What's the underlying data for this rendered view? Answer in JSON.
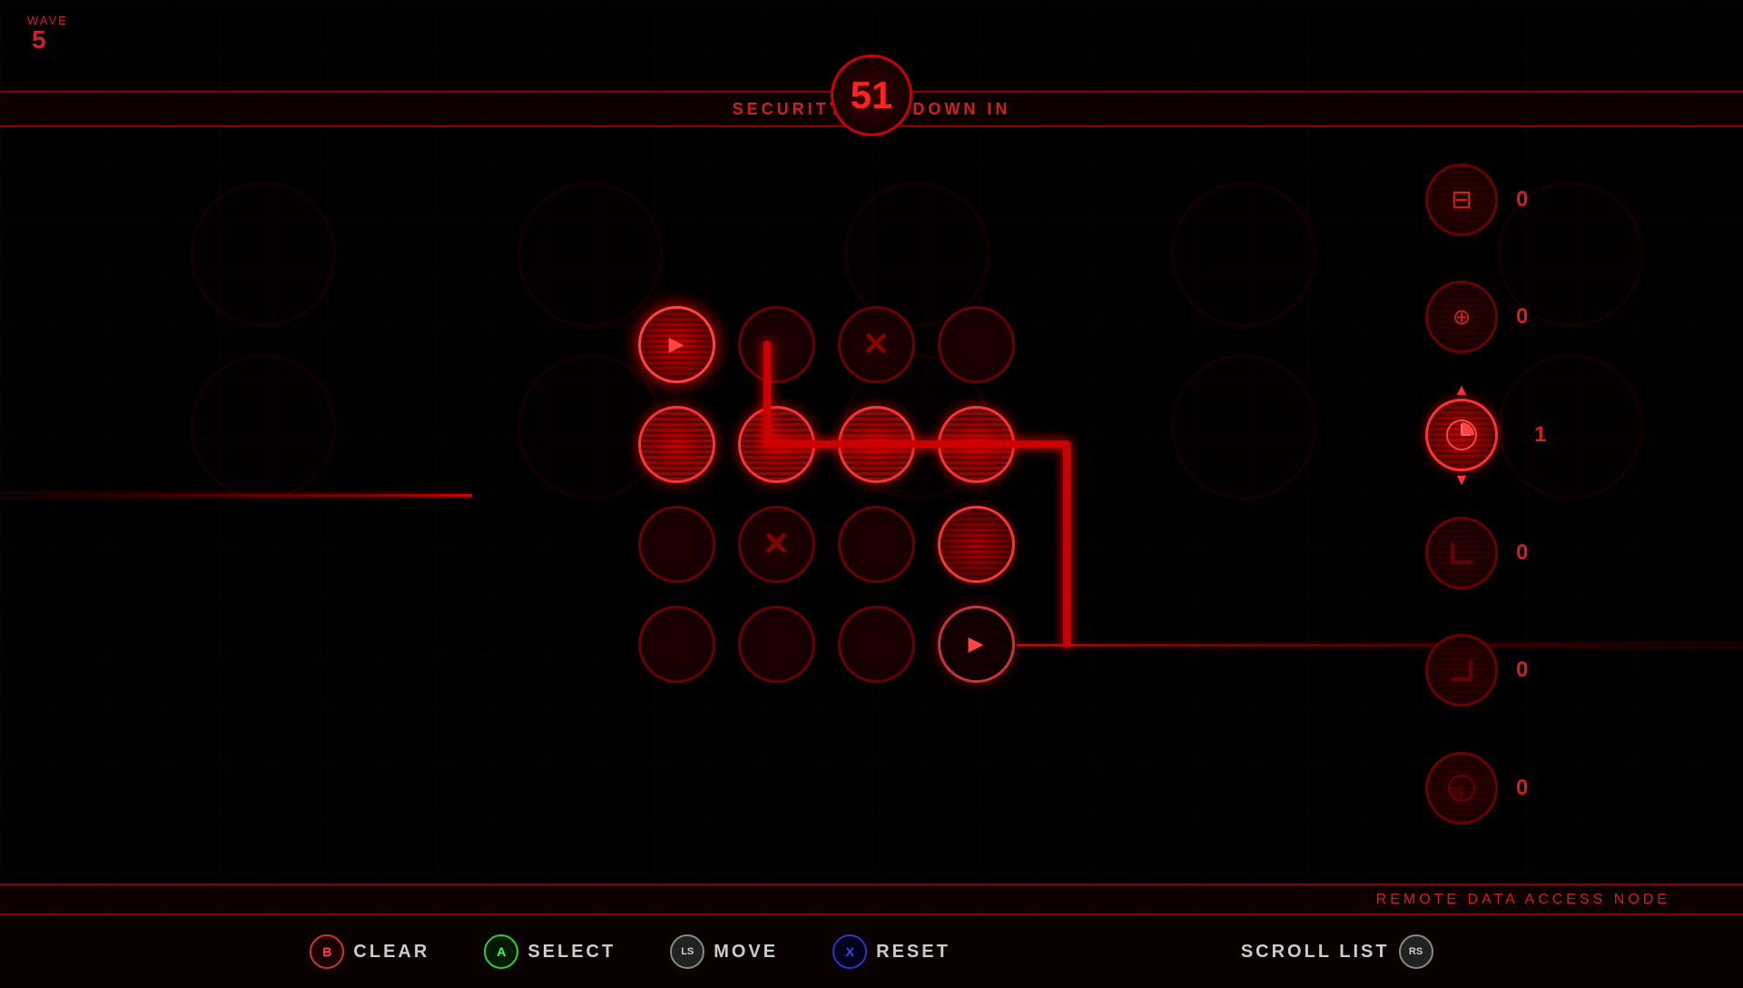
{
  "ui": {
    "wave_label": "WAVE",
    "wave_number": "5",
    "timer_value": "51",
    "header_text": "SECURITY LOCKDOWN IN",
    "footer_text": "REMOTE DATA ACCESS NODE",
    "buttons": [
      {
        "key": "B",
        "action": "CLEAR",
        "key_type": "btn-b"
      },
      {
        "key": "A",
        "action": "SELECT",
        "key_type": "btn-a"
      },
      {
        "key": "LS",
        "action": "MOVE",
        "key_type": "btn-ls"
      },
      {
        "key": "X",
        "action": "RESET",
        "key_type": "btn-x"
      }
    ],
    "scroll_label": "SCROLL LIST",
    "scroll_key": "RS"
  },
  "right_panel": [
    {
      "icon": "⊟",
      "count": "0",
      "active": false
    },
    {
      "icon": "⊕",
      "count": "0",
      "active": false
    },
    {
      "icon": "◔",
      "count": "1",
      "active": true
    },
    {
      "icon": "⌐",
      "count": "0",
      "active": false
    },
    {
      "icon": "⌐",
      "count": "0",
      "active": false
    },
    {
      "icon": "◔",
      "count": "0",
      "active": false
    }
  ],
  "grid": {
    "rows": 4,
    "cols": 4,
    "cells": [
      [
        {
          "state": "current",
          "arrow": "right"
        },
        {
          "state": "empty"
        },
        {
          "state": "marked-x"
        },
        {
          "state": "empty"
        }
      ],
      [
        {
          "state": "active"
        },
        {
          "state": "active"
        },
        {
          "state": "active"
        },
        {
          "state": "active"
        }
      ],
      [
        {
          "state": "empty"
        },
        {
          "state": "marked-x"
        },
        {
          "state": "empty"
        },
        {
          "state": "active-bottom"
        }
      ],
      [
        {
          "state": "empty"
        },
        {
          "state": "empty"
        },
        {
          "state": "empty"
        },
        {
          "state": "current-exit",
          "arrow": "right"
        }
      ]
    ]
  }
}
